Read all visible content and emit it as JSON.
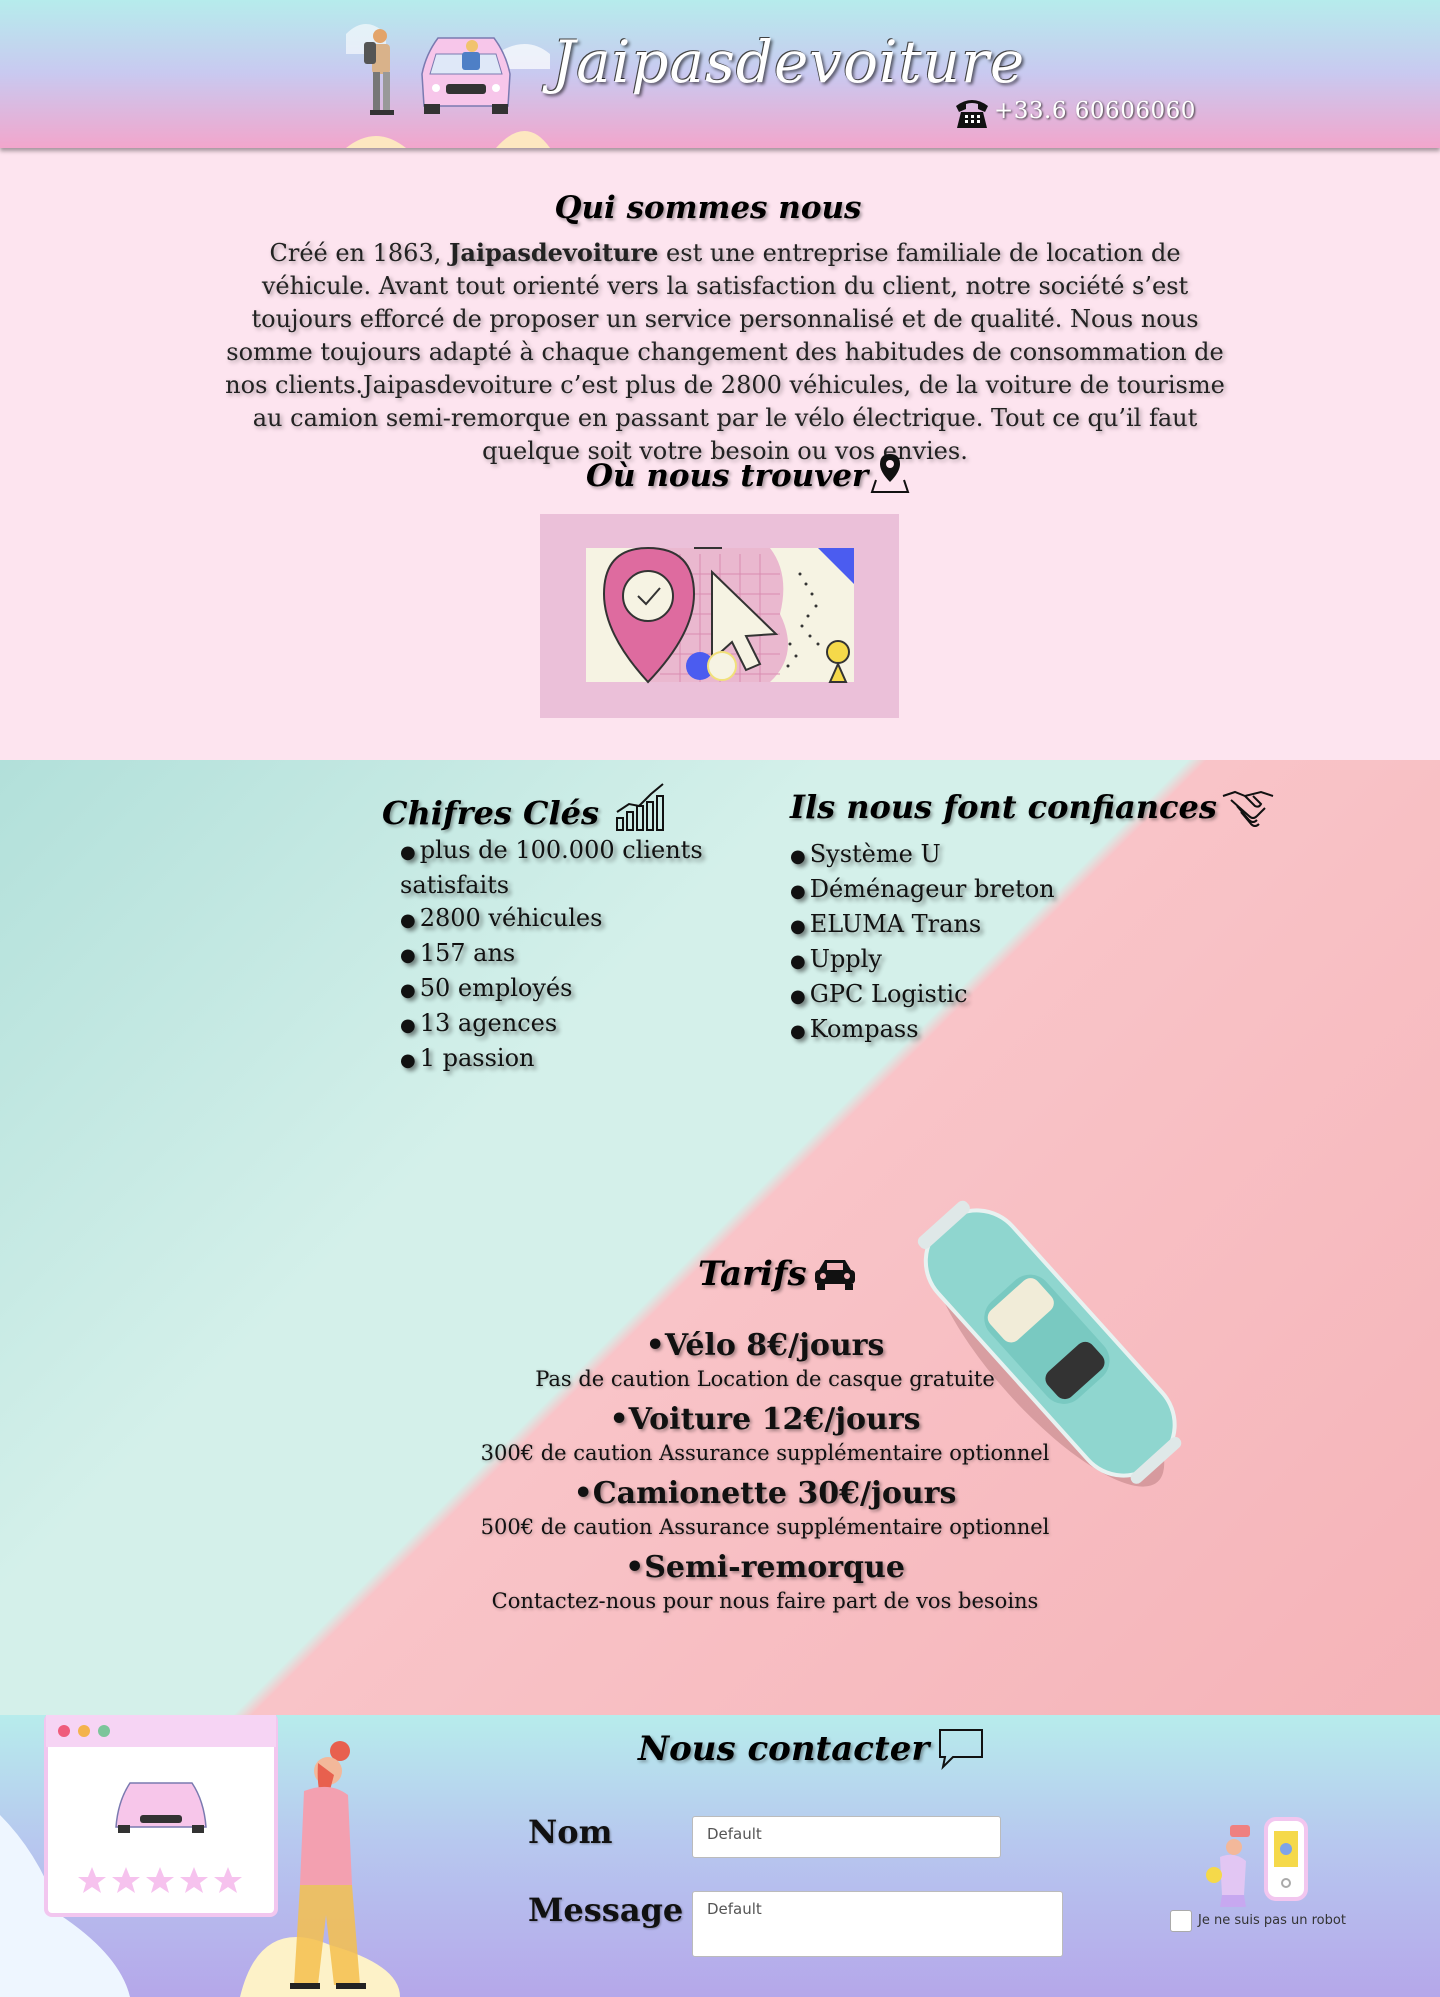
{
  "header": {
    "brand": "Jaipasdevoiture",
    "phone_icon": "telephone-icon",
    "phone_number": "+33.6 60606060"
  },
  "about": {
    "title": "Qui sommes nous",
    "text_before": "Créé en 1863, ",
    "text_bold": "Jaipasdevoiture",
    "text_after": " est une entreprise familiale de location de véhicule. Avant tout orienté vers la satisfaction du client, notre société s’est toujours efforcé de proposer un service personnalisé et de qualité. Nous nous somme toujours adapté à chaque changement des habitudes de consommation de nos clients.Jaipasdevoiture c’est plus de 2800 véhicules, de la voiture de tourisme au camion semi-remorque en passant par le vélo électrique. Tout ce qu’il faut quelque soit votre besoin ou vos envies."
  },
  "where": {
    "title": "Où nous trouver",
    "icon": "map-pin-icon"
  },
  "keys": {
    "title": "Chifres Clés",
    "icon": "bar-chart-icon",
    "items": [
      "plus de 100.000 clients satisfaits",
      "2800 véhicules",
      "157 ans",
      "50 employés",
      "13 agences",
      "1 passion"
    ]
  },
  "trust": {
    "title": "Ils nous font confiances",
    "icon": "handshake-icon",
    "items": [
      "Système U",
      "Déménageur breton",
      "ELUMA Trans",
      "Upply",
      "GPC Logistic",
      "Kompass"
    ]
  },
  "tarifs": {
    "title": "Tarifs",
    "icon": "car-icon",
    "items": [
      {
        "name": "•Vélo 8€/jours",
        "desc": "Pas de caution  Location de casque gratuite"
      },
      {
        "name": "•Voiture 12€/jours",
        "desc": "300€ de caution Assurance supplémentaire optionnel"
      },
      {
        "name": "•Camionette 30€/jours",
        "desc": "500€ de caution Assurance supplémentaire optionnel"
      },
      {
        "name": "•Semi-remorque",
        "desc": "Contactez-nous pour nous faire part de vos besoins"
      }
    ]
  },
  "contact": {
    "title": "Nous contacter",
    "icon": "speech-bubble-icon",
    "name_label": "Nom",
    "name_placeholder": "Default",
    "message_label": "Message",
    "message_placeholder": "Default",
    "captcha_label": "Je ne suis pas un robot"
  },
  "colors": {
    "header_top": "#b6ecec",
    "header_bottom": "#f2a6cc",
    "page_pink": "#fde4ef",
    "mint": "#d4f0ea",
    "salmon": "#f5b3b8"
  }
}
